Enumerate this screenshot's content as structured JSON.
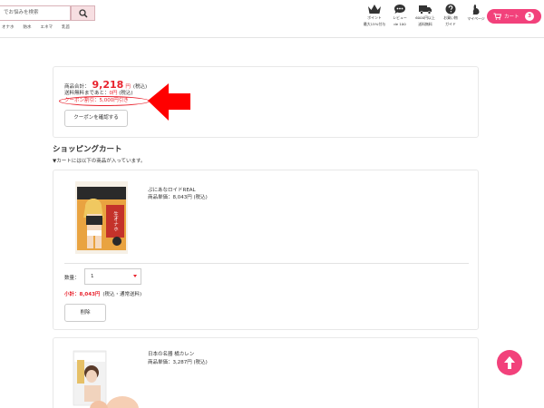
{
  "header": {
    "search_placeholder": "でお悩みを検索",
    "categories": [
      "オナホ",
      "防水",
      "エネマ",
      "乳首"
    ],
    "icons": [
      {
        "name": "crown-icon",
        "line1": "ポイント",
        "line2": "最大15%付与"
      },
      {
        "name": "chat-icon",
        "line1": "レビュー",
        "line2": "de 100"
      },
      {
        "name": "truck-icon",
        "line1": "6000円以上",
        "line2": "送料無料"
      },
      {
        "name": "question-icon",
        "line1": "お買い物",
        "line2": "ガイド"
      },
      {
        "name": "rabbit-icon",
        "line1": "マイページ",
        "line2": ""
      }
    ],
    "cart_label": "カート",
    "cart_count": "3"
  },
  "summary": {
    "total_label": "商品合計：",
    "total_value": "9,218",
    "total_unit": "円",
    "total_tax": "(税込)",
    "ship_label": "送料無料まであと：",
    "ship_value": "0",
    "ship_unit": "円",
    "ship_tax": "(税込)",
    "coupon_label": "クーポン割引：",
    "coupon_value": "5,000",
    "coupon_unit": "円引き",
    "coupon_button": "クーポンを確認する"
  },
  "section": {
    "title": "ショッピングカート",
    "subtitle": "▼カートには以下の商品が入っています。"
  },
  "items": [
    {
      "name": "ぷにあなロイドREAL",
      "price_label": "商品単価：",
      "price": "8,043",
      "price_unit": "円",
      "price_tax": "(税込)",
      "qty_label": "数量：",
      "qty_value": "1",
      "subtotal_label": "小計：8,043円",
      "subtotal_note": "(税込・通常送料)",
      "delete_label": "削除",
      "package_text": "生オナホ"
    },
    {
      "name": "日本の名器 橘カレン",
      "price_label": "商品単価：",
      "price": "3,287",
      "price_unit": "円",
      "price_tax": "(税込)"
    }
  ],
  "colors": {
    "accent": "#f2417b",
    "price_red": "#e8222d",
    "annotation_red": "#ff0000"
  }
}
